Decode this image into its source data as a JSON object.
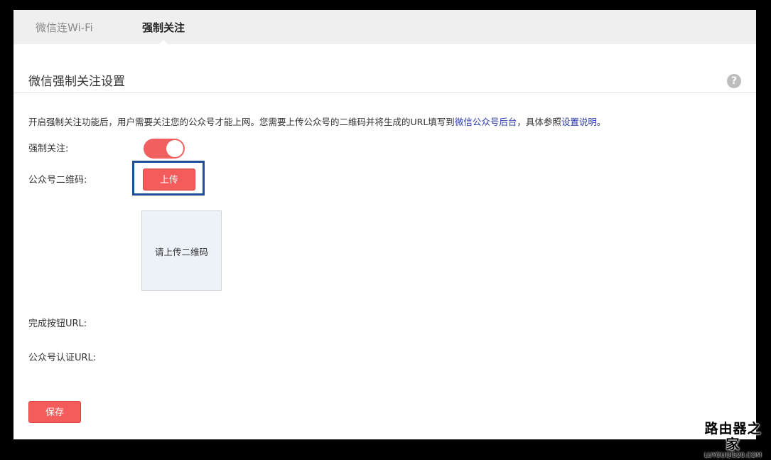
{
  "tabs": [
    {
      "label": "微信连Wi-Fi",
      "active": false
    },
    {
      "label": "强制关注",
      "active": true
    }
  ],
  "section": {
    "title": "微信强制关注设置",
    "help_icon": "question-circle-icon"
  },
  "description": {
    "text": "开启强制关注功能后，用户需要关注您的公众号才能上网。您需要上传公众号的二维码并将生成的URL填写到",
    "link1": "微信公众号后台",
    "middle": "，具体参照",
    "link2": "设置说明",
    "end": "。"
  },
  "form": {
    "force_follow_label": "强制关注:",
    "force_follow_enabled": true,
    "qr_label": "公众号二维码:",
    "upload_button": "上传",
    "qr_placeholder": "请上传二维码",
    "done_url_label": "完成按钮URL:",
    "auth_url_label": "公众号认证URL:",
    "save_button": "保存"
  },
  "watermark": {
    "title": "路由器之家",
    "subtitle": "LUYOUQI520.COM"
  },
  "colors": {
    "accent": "#f45c5c",
    "link": "#2a3aa6",
    "highlight_border": "#1f4e96",
    "tab_bar": "#efefef"
  }
}
